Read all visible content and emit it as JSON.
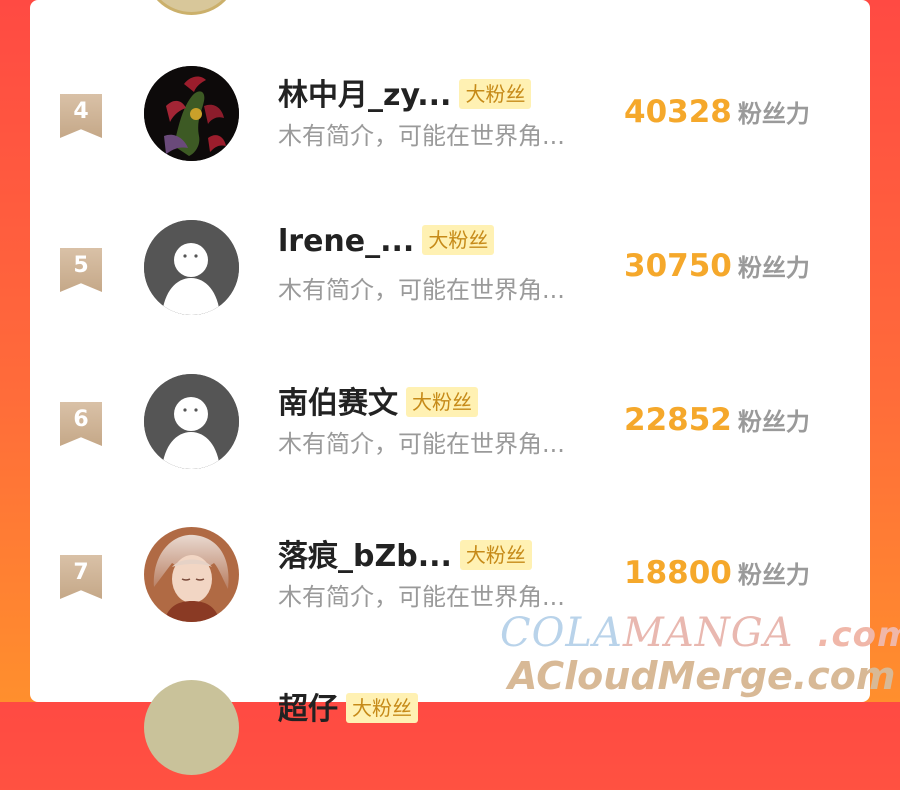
{
  "badge_label": "大粉丝",
  "unit_label": "粉丝力",
  "rows": [
    {
      "rank": "4",
      "name": "林中月_zy...",
      "bio": "木有简介，可能在世界角...",
      "score": "40328",
      "avatar": "dragon-artwork-avatar"
    },
    {
      "rank": "5",
      "name": "lrene_...",
      "bio": "木有简介，可能在世界角...",
      "score": "30750",
      "avatar": "default-avatar"
    },
    {
      "rank": "6",
      "name": "南伯赛文",
      "bio": "木有简介，可能在世界角...",
      "score": "22852",
      "avatar": "default-avatar"
    },
    {
      "rank": "7",
      "name": "落痕_bZb...",
      "bio": "木有简介，可能在世界角...",
      "score": "18800",
      "avatar": "anime-character-avatar"
    },
    {
      "rank": "",
      "name": "超仔",
      "bio": "",
      "score": "",
      "avatar": "partial-avatar"
    }
  ],
  "watermark": {
    "line1_a": "COLA",
    "line1_b": "MANGA",
    "line1_c": ".com",
    "line2": "ACloudMerge.com"
  },
  "colors": {
    "background_top": "#ff4a43",
    "background_bottom": "#ff8f2d",
    "score": "#f5a82b",
    "badge_bg": "#fff1b3",
    "badge_text": "#c68a18"
  }
}
